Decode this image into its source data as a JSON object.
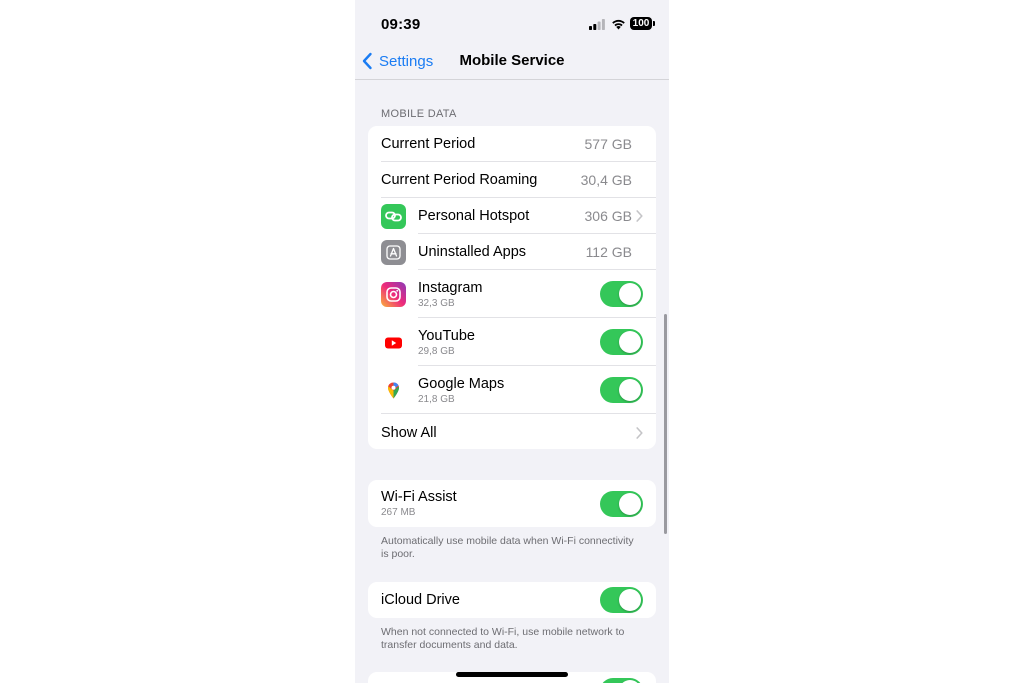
{
  "status_bar": {
    "time": "09:39",
    "battery": "100"
  },
  "nav": {
    "back_label": "Settings",
    "title": "Mobile Service"
  },
  "mobile_data": {
    "header": "MOBILE DATA",
    "current_period": {
      "label": "Current Period",
      "value": "577 GB"
    },
    "current_period_roaming": {
      "label": "Current Period Roaming",
      "value": "30,4 GB"
    },
    "personal_hotspot": {
      "label": "Personal Hotspot",
      "value": "306 GB",
      "icon": "hotspot-icon"
    },
    "uninstalled_apps": {
      "label": "Uninstalled Apps",
      "value": "112 GB",
      "icon": "app-store-icon"
    },
    "apps": [
      {
        "label": "Instagram",
        "usage": "32,3 GB",
        "icon": "instagram-icon",
        "enabled": true
      },
      {
        "label": "YouTube",
        "usage": "29,8 GB",
        "icon": "youtube-icon",
        "enabled": true
      },
      {
        "label": "Google Maps",
        "usage": "21,8 GB",
        "icon": "google-maps-icon",
        "enabled": true
      }
    ],
    "show_all": "Show All"
  },
  "wifi_assist": {
    "label": "Wi-Fi Assist",
    "usage": "267 MB",
    "enabled": true,
    "footer": "Automatically use mobile data when Wi-Fi connectivity is poor."
  },
  "icloud_drive": {
    "label": "iCloud Drive",
    "enabled": true,
    "footer": "When not connected to Wi-Fi, use mobile network to transfer documents and data."
  },
  "colors": {
    "accent": "#1a7cf3",
    "toggle_on": "#34c759",
    "hotspot": "#34c759",
    "uninstalled": "#8e8e93"
  }
}
